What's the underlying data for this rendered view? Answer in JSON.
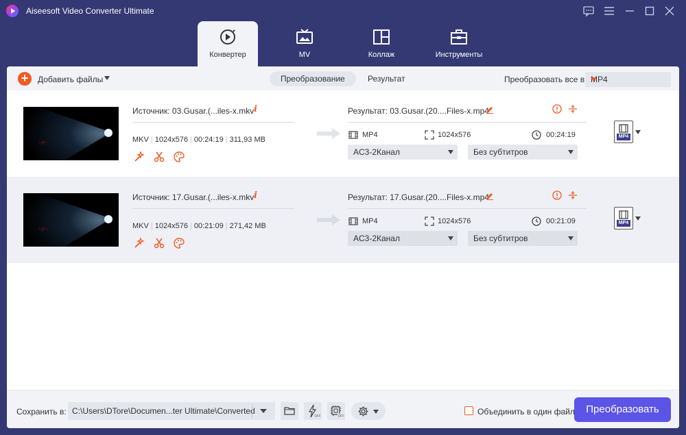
{
  "app": {
    "title": "Aiseesoft Video Converter Ultimate"
  },
  "nav": {
    "tabs": [
      {
        "label": "Конвертер",
        "icon": "converter-icon",
        "active": true
      },
      {
        "label": "MV",
        "icon": "tv-icon",
        "active": false
      },
      {
        "label": "Коллаж",
        "icon": "collage-icon",
        "active": false
      },
      {
        "label": "Инструменты",
        "icon": "toolbox-icon",
        "active": false
      }
    ]
  },
  "toolbar": {
    "add_files_label": "Добавить файлы",
    "tab_convert": "Преобразование",
    "tab_result": "Результат",
    "convert_all_label": "Преобразовать все в:",
    "convert_all_value": "MP4"
  },
  "files": [
    {
      "source": "Источник: 03.Gusar.(...iles-x.mkv",
      "container": "MKV",
      "resolution": "1024x576",
      "duration": "00:24:19",
      "size": "311,93 MB",
      "result": "Результат: 03.Gusar.(20....Files-x.mp4",
      "out_format": "MP4",
      "out_resolution": "1024x576",
      "out_duration": "00:24:19",
      "audio": "AC3-2Канал",
      "subtitles": "Без субтитров",
      "badge": "MP4"
    },
    {
      "source": "Источник: 17.Gusar.(...iles-x.mkv",
      "container": "MKV",
      "resolution": "1024x576",
      "duration": "00:21:09",
      "size": "271,42 MB",
      "result": "Результат: 17.Gusar.(20....Files-x.mp4",
      "out_format": "MP4",
      "out_resolution": "1024x576",
      "out_duration": "00:21:09",
      "audio": "AC3-2Канал",
      "subtitles": "Без субтитров",
      "badge": "MP4"
    }
  ],
  "footer": {
    "save_label": "Сохранить в:",
    "save_path": "C:\\Users\\DTore\\Documen...ter Ultimate\\Converted",
    "merge_label": "Объединить в один файл",
    "merge_checked": false,
    "convert_button": "Преобразовать"
  },
  "colors": {
    "chrome": "#343873",
    "accent": "#f15a22",
    "primary_button": "#5b54e7"
  }
}
